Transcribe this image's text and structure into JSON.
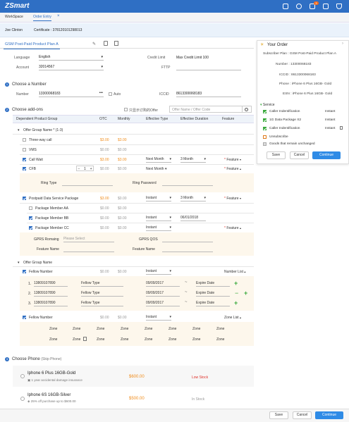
{
  "app": {
    "title": "ZSmart",
    "notification_count": "3"
  },
  "tabs": [
    {
      "label": "WorkSpace"
    },
    {
      "label": "Order Entry"
    }
  ],
  "customer": {
    "name": "Joe Clinton",
    "certificate": "Certificate : 378120101298013"
  },
  "plan_tab": "GSM Post-Paid Product Plan A",
  "form": {
    "language_label": "Language",
    "language_value": "English",
    "account_label": "Account",
    "account_value": "32014567",
    "credit_label": "Credit Limit",
    "credit_value": "Max Credit Limit 100",
    "fttp_label": "FTTP"
  },
  "step1": {
    "num": "1",
    "title": "Choose a Number",
    "number_label": "Number",
    "number_value": "13300068183",
    "auto_label": "Auto",
    "iccid_label": "ICCID",
    "iccid_value": "8613300068183"
  },
  "step2": {
    "num": "2",
    "title": "Choose add-ons",
    "filter_label": "只显示订购的Offer",
    "search_placeholder": "Offer Name / Offer Code"
  },
  "table": {
    "headers": {
      "group": "Dependent Product Group",
      "otc": "OTC",
      "monthly": "Monthly",
      "eff_type": "Effective Type",
      "eff_dur": "Effective Duration",
      "feature": "Feature"
    },
    "group1": "Offer Group Name * (1-3)",
    "rows": [
      {
        "name": "Three-way call",
        "otc": "$3.00",
        "monthly": "$3.00"
      },
      {
        "name": "VMS",
        "otc": "$0.00",
        "monthly": "$0.00"
      },
      {
        "name": "Call Wait",
        "otc": "$3.00",
        "monthly": "$3.00",
        "eff_type": "Next Month",
        "eff_dur": "3 Month",
        "feature": "Feature"
      },
      {
        "name": "CFB",
        "qty": "1",
        "otc": "$0.00",
        "monthly": "$0.00",
        "eff_type": "Next Month",
        "feature": "Feature"
      }
    ],
    "ring_type": "Ring Type",
    "ring_password": "Ring Password",
    "pkg": {
      "name": "Postpaid Data Service Package",
      "otc": "$3.00",
      "monthly": "$0.00",
      "eff_type": "Instant",
      "eff_dur": "3 Month",
      "feature": "Feature"
    },
    "members": [
      {
        "name": "Package Member AA",
        "otc": "$0.00",
        "monthly": "$0.00"
      },
      {
        "name": "Package Member BB",
        "otc": "$0.00",
        "monthly": "$0.00",
        "eff_type": "Instant",
        "eff_dur": "06/01/2018"
      },
      {
        "name": "Package Member CC",
        "otc": "$0.00",
        "monthly": "$0.00",
        "eff_type": "Instant",
        "feature": "Feature"
      }
    ],
    "gprs_roaming": "GPRS Romaing",
    "gprs_placeholder": "Please Select",
    "gprs_qos": "GPRS QOS",
    "feature_name1": "Feature Name",
    "feature_name2": "Feature Name",
    "group2": "Offer Group Name",
    "fellow": {
      "name": "Fellow Number",
      "otc": "$0.00",
      "monthly": "$0.00",
      "eff_type": "Instant",
      "list": "Number List"
    },
    "fellow_rows": [
      {
        "idx": "1.",
        "num": "13809107890",
        "type": "Fellow Type",
        "date": "09/09/2017",
        "expire": "Expire Date"
      },
      {
        "idx": "2.",
        "num": "13809107890",
        "type": "Fellow Type",
        "date": "09/09/2017",
        "expire": "Expire Date"
      },
      {
        "idx": "3.",
        "num": "13809107890",
        "type": "Fellow Type",
        "date": "09/09/2017",
        "expire": "Expire Date"
      }
    ],
    "tilde": "~",
    "fellow2": {
      "name": "Fellow Number",
      "otc": "$0.00",
      "monthly": "$0.00",
      "eff_type": "Instant",
      "list": "Zone List"
    },
    "zone": "Zone"
  },
  "step3": {
    "num": "3",
    "title": "Choose Phone",
    "skip": "(Skip Phone)"
  },
  "phones": [
    {
      "name": "Iphone 6 Plus 16GB-Gold",
      "desc": "1 year accidental damage insurance",
      "price": "$600.00",
      "stock": "Low Stock"
    },
    {
      "name": "Iphone 6S 16GB-Silver",
      "desc": "25% off purchase up to $600.00",
      "price": "$500.00",
      "stock": "In Stock"
    }
  ],
  "order": {
    "title": "Your Order",
    "subscriber_plan": "Subscriber Plan : GSM Post-Paid Product Plan A",
    "number": "Number : 13300068183",
    "iccid": "ICCID : 8613300068183",
    "phone": "Phone : iPhone 6 Plus 16GB- Gold",
    "esn": "ESN : iPhone 6 Plus 16GB- Gold",
    "service_label": "Service",
    "services": [
      {
        "name": "Caller Indentification",
        "type": "Instant"
      },
      {
        "name": "1G Data Package   X2",
        "type": "Instant"
      },
      {
        "name": "Caller Indentification",
        "type": "Instant"
      }
    ],
    "unsubscribe": "Unsubscribe",
    "unchanged": "Goods that remain unchanged",
    "save": "Save",
    "cancel": "Cancel",
    "continue": "Continue"
  },
  "bottom": {
    "save": "Save",
    "cancel": "Cancel",
    "continue": "Continue"
  },
  "colors": {
    "brand": "#2f6fc4",
    "accent_orange": "#f08c1b",
    "green": "#39a93b",
    "red": "#e0332c"
  }
}
